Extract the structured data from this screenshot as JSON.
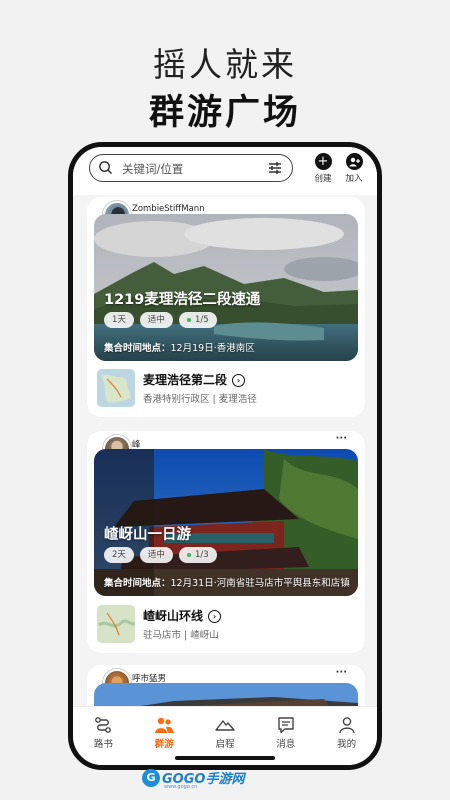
{
  "promo": {
    "line1": "摇人就来",
    "line2": "群游广场"
  },
  "search": {
    "placeholder": "关键词/位置"
  },
  "top_actions": {
    "create": "创建",
    "join": "加入",
    "create_icon": "+",
    "join_icon": "+"
  },
  "posts": [
    {
      "user": "ZombieStiffMann",
      "title": "1219麦理浩径二段速通",
      "tags": [
        "1天",
        "适中",
        "1/5"
      ],
      "meta_label": "集合时间地点：",
      "meta_value": "12月19日·香港南区",
      "route_name": "麦理浩径第二段",
      "route_sub": "香港特别行政区 | 麦理浩径"
    },
    {
      "user": "峰",
      "title": "嵖岈山一日游",
      "tags": [
        "2天",
        "适中",
        "1/3"
      ],
      "meta_label": "集合时间地点：",
      "meta_value": "12月31日·河南省驻马店市平舆县东和店镇",
      "route_name": "嵖岈山环线",
      "route_sub": "驻马店市 | 嵖岈山"
    },
    {
      "user": "呼市猛男"
    }
  ],
  "more_icon": "···",
  "route_arrow": "›",
  "tabs": [
    {
      "label": "路书",
      "icon": "route-icon"
    },
    {
      "label": "群游",
      "icon": "group-icon",
      "active": true
    },
    {
      "label": "启程",
      "icon": "mountain-icon"
    },
    {
      "label": "消息",
      "icon": "message-icon"
    },
    {
      "label": "我的",
      "icon": "profile-icon"
    }
  ],
  "watermark": {
    "logo": "G",
    "text": "GOGO手游网",
    "url": "www.gogo.cn"
  },
  "colors": {
    "accent": "#ff6a13",
    "tag_dot": "#3cba54"
  }
}
